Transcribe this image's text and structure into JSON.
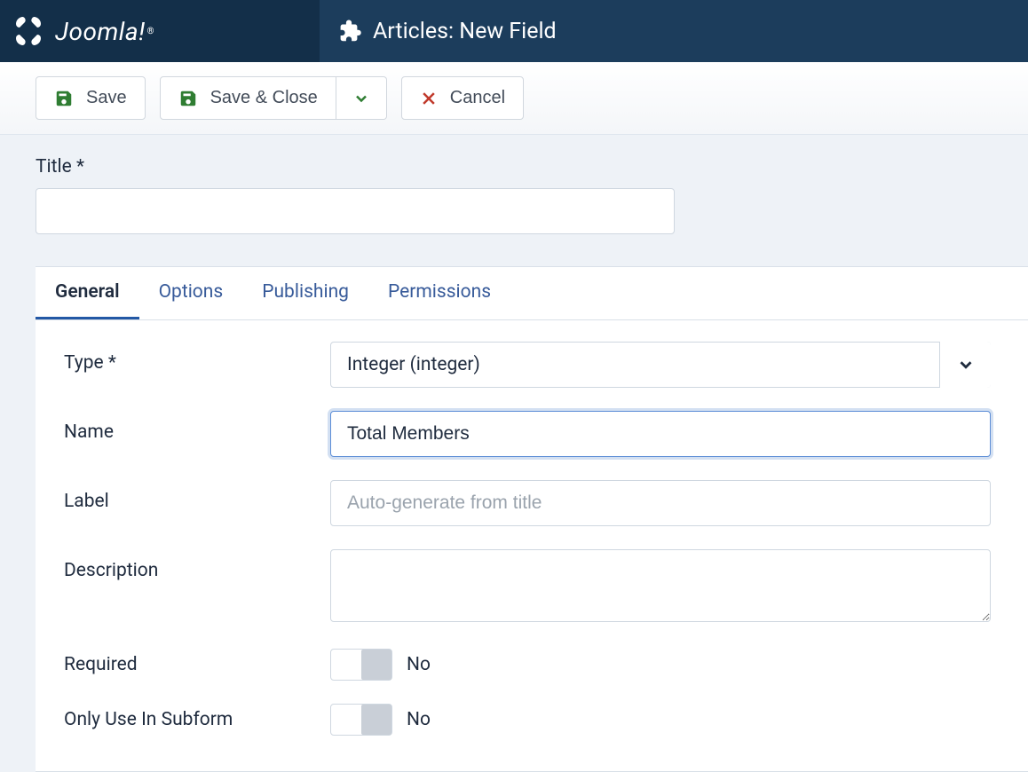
{
  "brand": {
    "name": "Joomla!"
  },
  "header": {
    "title": "Articles: New Field"
  },
  "toolbar": {
    "save_label": "Save",
    "save_close_label": "Save & Close",
    "cancel_label": "Cancel"
  },
  "title_field": {
    "label": "Title *",
    "value": ""
  },
  "tabs": {
    "general": "General",
    "options": "Options",
    "publishing": "Publishing",
    "permissions": "Permissions"
  },
  "form": {
    "type": {
      "label": "Type *",
      "value": "Integer (integer)"
    },
    "name": {
      "label": "Name",
      "value": "Total Members"
    },
    "label_field": {
      "label": "Label",
      "value": "",
      "placeholder": "Auto-generate from title"
    },
    "description": {
      "label": "Description",
      "value": ""
    },
    "required": {
      "label": "Required",
      "value_label": "No"
    },
    "only_subform": {
      "label": "Only Use In Subform",
      "value_label": "No"
    }
  }
}
